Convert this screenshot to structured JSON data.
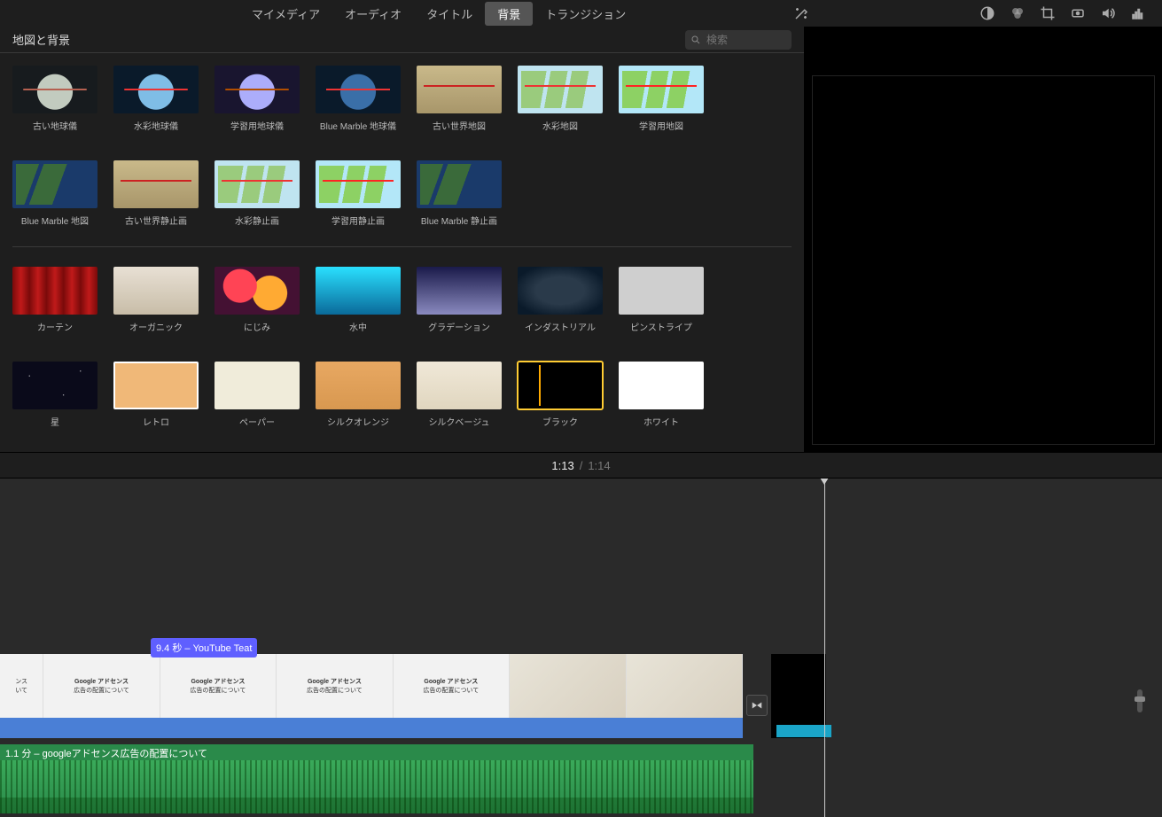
{
  "tabs": {
    "mymedia": "マイメディア",
    "audio": "オーディオ",
    "title": "タイトル",
    "background": "背景",
    "transition": "トランジション"
  },
  "browser": {
    "title": "地図と背景",
    "search_placeholder": "検索"
  },
  "thumbs": {
    "r1": [
      "古い地球儀",
      "水彩地球儀",
      "学習用地球儀",
      "Blue Marble 地球儀",
      "古い世界地図",
      "水彩地図",
      "学習用地図"
    ],
    "r2": [
      "Blue Marble 地図",
      "古い世界静止画",
      "水彩静止画",
      "学習用静止画",
      "Blue Marble 静止画"
    ],
    "r3": [
      "カーテン",
      "オーガニック",
      "にじみ",
      "水中",
      "グラデーション",
      "インダストリアル",
      "ピンストライプ"
    ],
    "r4": [
      "星",
      "レトロ",
      "ペーパー",
      "シルクオレンジ",
      "シルクベージュ",
      "ブラック",
      "ホワイト"
    ]
  },
  "time": {
    "current": "1:13",
    "sep": "/",
    "duration": "1:14"
  },
  "timeline": {
    "tooltip": "9.4 秒 – YouTube Teat",
    "frame_title": "Google アドセンス",
    "frame_sub": "広告の配置について",
    "audio_label": "1.1 分 – googleアドセンス広告の配置について"
  }
}
